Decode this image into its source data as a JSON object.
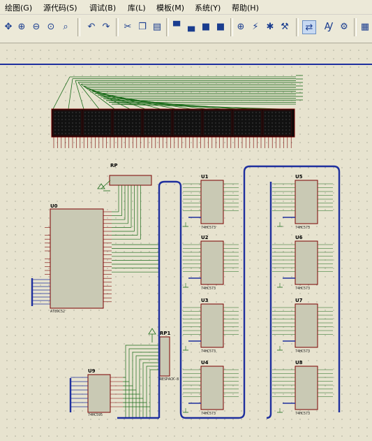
{
  "menu": {
    "items": [
      "绘图(G)",
      "源代码(S)",
      "调试(B)",
      "库(L)",
      "模板(M)",
      "系统(Y)",
      "帮助(H)"
    ]
  },
  "toolbar": {
    "icons": [
      "move-icon",
      "zoom-in-icon",
      "zoom-out-icon",
      "zoom-all-icon",
      "zoom-area-icon",
      "undo-icon",
      "redo-icon",
      "cut-icon",
      "copy-icon",
      "paste-icon",
      "block-copy-icon",
      "block-move-icon",
      "block-rotate-icon",
      "block-delete-icon",
      "pick-device-icon",
      "make-device-icon",
      "package-icon",
      "decompose-icon",
      "wire-autorouter-icon",
      "search-tag-icon",
      "property-tool-icon",
      "netlist-icon"
    ]
  },
  "schematic": {
    "components": {
      "rp": "RP",
      "rp1": "RP1",
      "u0": "U0",
      "u9": "U9",
      "u1": "U1",
      "u2": "U2",
      "u3": "U3",
      "u4": "U4",
      "u5": "U5",
      "u6": "U6",
      "u7": "U7",
      "u8": "U8"
    },
    "u0_part": "AT89C52",
    "rp1_part": "RESPACK-8",
    "u9_part": "74HC595",
    "latch_part": "74HC573"
  }
}
